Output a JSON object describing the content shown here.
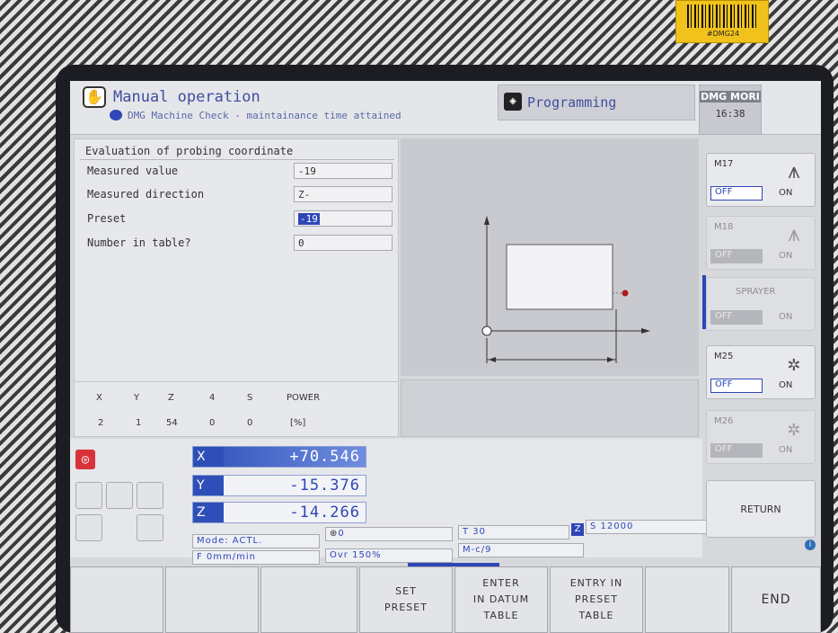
{
  "sticker_text": "#DMG24",
  "header": {
    "mode_title": "Manual operation",
    "mode_subtitle": "DMG Machine Check - maintainance time attained",
    "programming_label": "Programming",
    "brand_logo_text": "DMG MORI",
    "clock": "16:38"
  },
  "probe_form": {
    "title": "Evaluation of probing coordinate",
    "fields": [
      {
        "label": "Measured value",
        "value": "-19"
      },
      {
        "label": "Measured direction",
        "value": "Z-"
      },
      {
        "label": "Preset",
        "value": "-19"
      },
      {
        "label": "Number in table?",
        "value": "0"
      }
    ]
  },
  "load_table": {
    "headers": [
      "X",
      "Y",
      "Z",
      "4",
      "S",
      "POWER"
    ],
    "values": [
      "2",
      "1",
      "54",
      "0",
      "0",
      "[%]"
    ]
  },
  "positions": [
    {
      "axis": "X",
      "value": "+70.546"
    },
    {
      "axis": "Y",
      "value": "-15.376"
    },
    {
      "axis": "Z",
      "value": "-14.266"
    }
  ],
  "status": {
    "mode": "Mode: ACTL.",
    "feed": "F 0mm/min",
    "spindle_override_value": "0",
    "override": "Ovr 150%",
    "tool": "T 30",
    "z_badge": "Z",
    "spindle_speed": "S 12000",
    "m_code": "M-c/9"
  },
  "side_keys": [
    {
      "label": "M17",
      "off": "OFF",
      "on": "ON",
      "enabled": true,
      "icon": "coolant-nozzle-icon"
    },
    {
      "label": "M18",
      "off": "OFF",
      "on": "ON",
      "enabled": false,
      "icon": "coolant-nozzle-icon"
    },
    {
      "label": "SPRAYER",
      "off": "OFF",
      "on": "ON",
      "enabled": false,
      "icon": ""
    },
    {
      "label": "M25",
      "off": "OFF",
      "on": "ON",
      "enabled": true,
      "icon": "snowflake-icon"
    },
    {
      "label": "M26",
      "off": "OFF",
      "on": "ON",
      "enabled": false,
      "icon": "snowflake-icon"
    }
  ],
  "return_label": "RETURN",
  "softkeys": [
    "",
    "",
    "",
    "SET\nPRESET",
    "ENTER\nIN DATUM\nTABLE",
    "ENTRY IN\nPRESET\nTABLE",
    "",
    "END"
  ],
  "colors": {
    "accent_blue": "#2f46b8",
    "red_icon": "#d8323a",
    "probe_dot": "#b01820"
  }
}
